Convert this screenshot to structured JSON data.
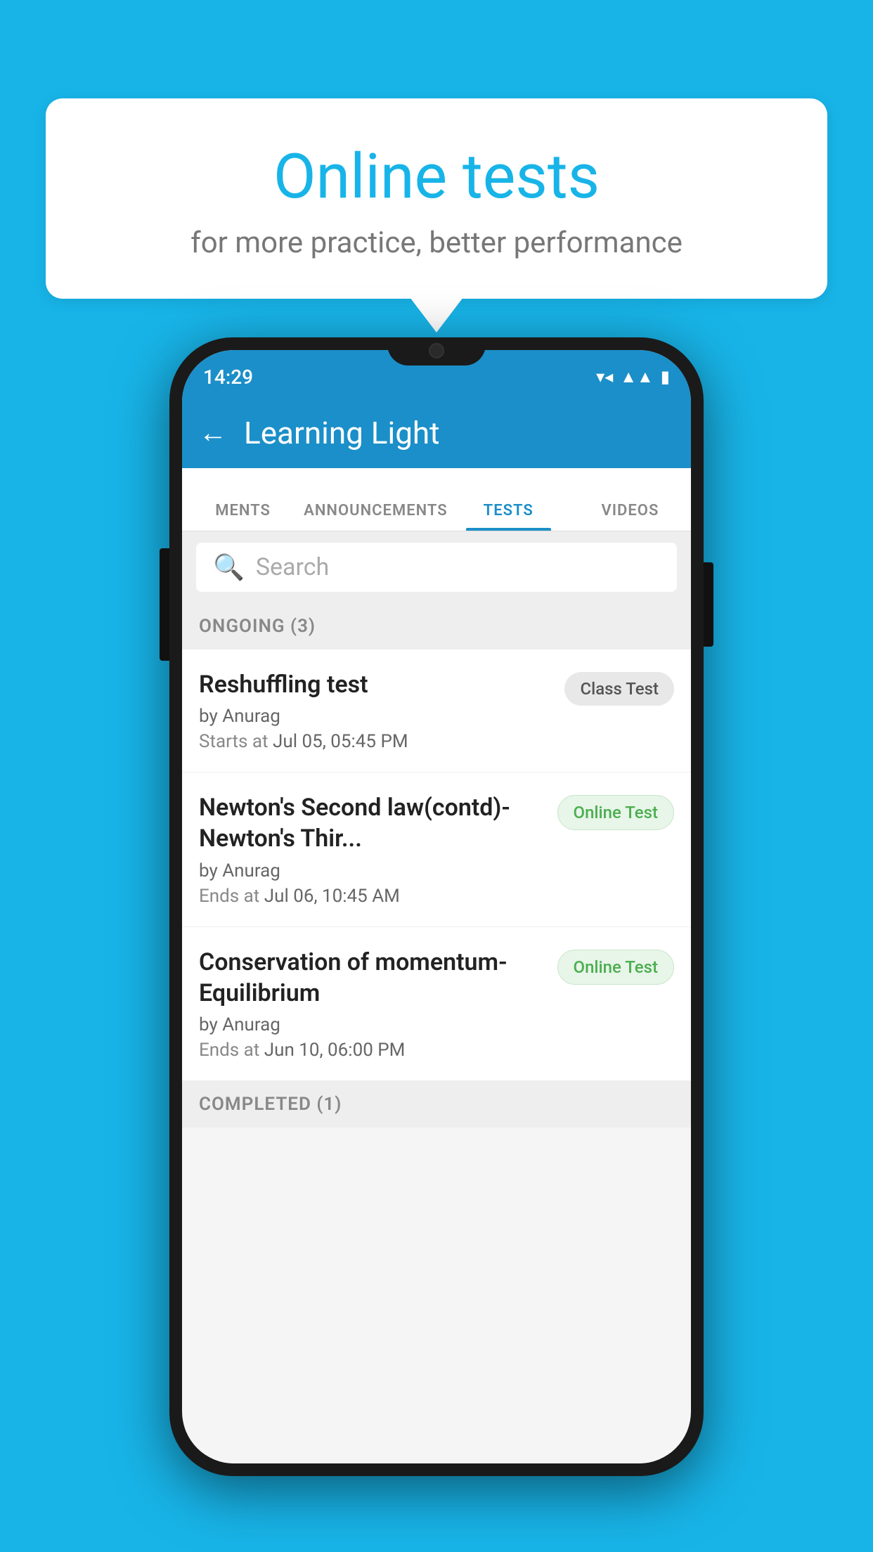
{
  "background_color": "#18B4E8",
  "speech_bubble": {
    "title": "Online tests",
    "subtitle": "for more practice, better performance"
  },
  "phone": {
    "status_bar": {
      "time": "14:29",
      "wifi": "▼▲",
      "signal": "▲",
      "battery": "▮"
    },
    "app_bar": {
      "back_label": "←",
      "title": "Learning Light"
    },
    "tabs": [
      {
        "label": "MENTS",
        "active": false
      },
      {
        "label": "ANNOUNCEMENTS",
        "active": false
      },
      {
        "label": "TESTS",
        "active": true
      },
      {
        "label": "VIDEOS",
        "active": false
      }
    ],
    "search": {
      "placeholder": "Search"
    },
    "ongoing_section": {
      "title": "ONGOING (3)"
    },
    "test_items": [
      {
        "name": "Reshuffling test",
        "author": "by Anurag",
        "time_label": "Starts at",
        "time_value": "Jul 05, 05:45 PM",
        "badge": "Class Test",
        "badge_type": "class"
      },
      {
        "name": "Newton's Second law(contd)-Newton's Thir...",
        "author": "by Anurag",
        "time_label": "Ends at",
        "time_value": "Jul 06, 10:45 AM",
        "badge": "Online Test",
        "badge_type": "online"
      },
      {
        "name": "Conservation of momentum-Equilibrium",
        "author": "by Anurag",
        "time_label": "Ends at",
        "time_value": "Jun 10, 06:00 PM",
        "badge": "Online Test",
        "badge_type": "online"
      }
    ],
    "completed_section": {
      "title": "COMPLETED (1)"
    }
  }
}
